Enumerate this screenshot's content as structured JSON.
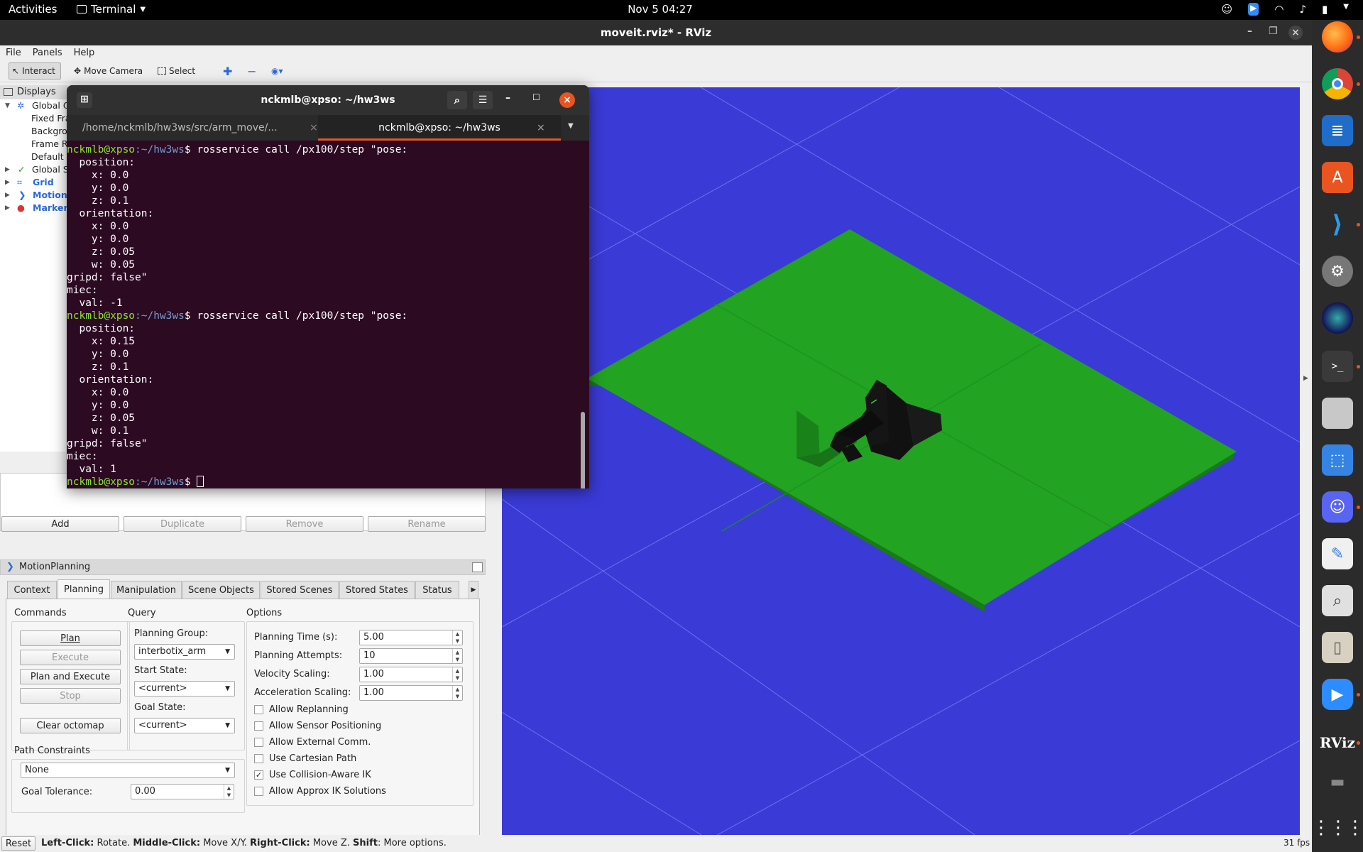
{
  "topbar": {
    "activities": "Activities",
    "app_name": "Terminal",
    "datetime": "Nov 5  04:27"
  },
  "rviz": {
    "window_title": "moveit.rviz* - RViz",
    "menu": [
      "File",
      "Panels",
      "Help"
    ],
    "toolbar": {
      "interact": "Interact",
      "move_camera": "Move Camera",
      "select": "Select"
    },
    "displays": {
      "header": "Displays",
      "items": [
        {
          "label": "Global Options"
        },
        {
          "label": "Fixed Frame"
        },
        {
          "label": "Background Color"
        },
        {
          "label": "Frame Rate"
        },
        {
          "label": "Default Light"
        },
        {
          "label": "Global Status: Ok"
        },
        {
          "label": "Grid"
        },
        {
          "label": "MotionPlanning"
        },
        {
          "label": "MarkerArray"
        }
      ],
      "buttons": {
        "add": "Add",
        "duplicate": "Duplicate",
        "remove": "Remove",
        "rename": "Rename"
      }
    },
    "motion_planning": {
      "title": "MotionPlanning",
      "tabs": [
        "Context",
        "Planning",
        "Manipulation",
        "Scene Objects",
        "Stored Scenes",
        "Stored States",
        "Status"
      ],
      "selected_tab": "Planning",
      "commands": {
        "title": "Commands",
        "plan": "Plan",
        "execute": "Execute",
        "plan_and_execute": "Plan and Execute",
        "stop": "Stop",
        "clear_octomap": "Clear octomap"
      },
      "query": {
        "title": "Query",
        "planning_group_label": "Planning Group:",
        "planning_group_value": "interbotix_arm",
        "start_state_label": "Start State:",
        "start_state_value": "<current>",
        "goal_state_label": "Goal State:",
        "goal_state_value": "<current>"
      },
      "options": {
        "title": "Options",
        "planning_time_label": "Planning Time (s):",
        "planning_time": "5.00",
        "planning_attempts_label": "Planning Attempts:",
        "planning_attempts": "10",
        "velocity_scaling_label": "Velocity Scaling:",
        "velocity_scaling": "1.00",
        "acceleration_scaling_label": "Acceleration Scaling:",
        "acceleration_scaling": "1.00",
        "checkboxes": [
          {
            "label": "Allow Replanning",
            "checked": false
          },
          {
            "label": "Allow Sensor Positioning",
            "checked": false
          },
          {
            "label": "Allow External Comm.",
            "checked": false
          },
          {
            "label": "Use Cartesian Path",
            "checked": false
          },
          {
            "label": "Use Collision-Aware IK",
            "checked": true
          },
          {
            "label": "Allow Approx IK Solutions",
            "checked": false
          }
        ]
      },
      "path_constraints": {
        "title": "Path Constraints",
        "value": "None",
        "goal_tolerance_label": "Goal Tolerance:",
        "goal_tolerance": "0.00"
      }
    },
    "status": {
      "reset": "Reset",
      "left": "Left-Click:",
      "left_desc": "Rotate.",
      "middle": "Middle-Click:",
      "middle_desc": "Move X/Y.",
      "right": "Right-Click:",
      "right_desc": "Move Z.",
      "shift": "Shift",
      "shift_desc": ": More options.",
      "fps": "31 fps"
    }
  },
  "terminal": {
    "title": "nckmlb@xpso: ~/hw3ws",
    "tab1": "/home/nckmlb/hw3ws/src/arm_move/...",
    "tab2": "nckmlb@xpso: ~/hw3ws",
    "prompt_user": "nckmlb@xpso",
    "prompt_path": ":~/hw3ws",
    "prompt_dollar": "$",
    "command": " rosservice call /px100/step \"pose:",
    "block1": [
      "  position:",
      "    x: 0.0",
      "    y: 0.0",
      "    z: 0.1",
      "  orientation:",
      "    x: 0.0",
      "    y: 0.0",
      "    z: 0.05",
      "    w: 0.05",
      "gripd: false\"",
      "miec:",
      "  val: -1"
    ],
    "block2": [
      "  position:",
      "    x: 0.15",
      "    y: 0.0",
      "    z: 0.1",
      "  orientation:",
      "    x: 0.0",
      "    y: 0.0",
      "    z: 0.05",
      "    w: 0.1",
      "gripd: false\"",
      "miec:",
      "  val: 1"
    ]
  },
  "dock": {
    "items": [
      "firefox-icon",
      "chrome-icon",
      "writer-icon",
      "software-icon",
      "vscode-icon",
      "settings-icon",
      "camera-icon",
      "terminal-icon",
      "files-icon",
      "screenshot-icon",
      "discord-icon",
      "text-editor-icon",
      "image-viewer-icon",
      "archive-icon",
      "zoom-icon"
    ],
    "rviz_label": "RViz"
  },
  "colors": {
    "view_background": "#3a3ad6",
    "plane": "#22a322",
    "terminal_bg": "#2c0a22",
    "accent": "#e95420"
  }
}
